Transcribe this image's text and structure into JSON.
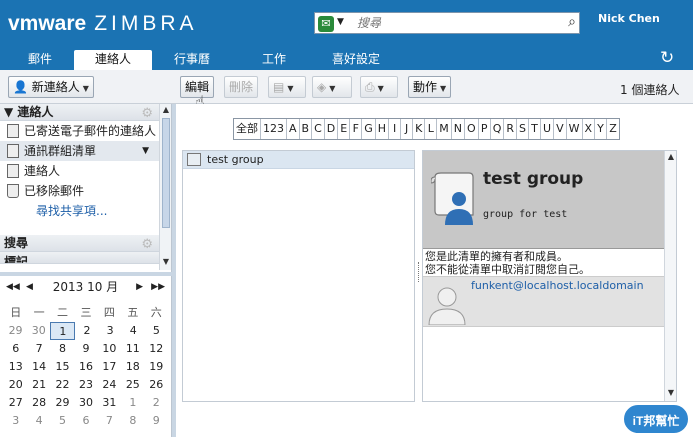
{
  "header": {
    "logo_brand": "vmware",
    "logo_product": "ZIMBRA",
    "search_placeholder": "搜尋",
    "user_name": "Nick Chen"
  },
  "tabs": [
    {
      "label": "郵件",
      "active": false
    },
    {
      "label": "連絡人",
      "active": true
    },
    {
      "label": "行事曆",
      "active": false
    },
    {
      "label": "工作",
      "active": false
    },
    {
      "label": "喜好設定",
      "active": false
    }
  ],
  "toolbar": {
    "new_contact": "新連絡人",
    "edit": "編輯",
    "delete": "刪除",
    "actions": "動作",
    "contact_count": "1 個連絡人"
  },
  "sidebar": {
    "section_contacts": "連絡人",
    "items": [
      {
        "label": "已寄送電子郵件的連絡人"
      },
      {
        "label": "通訊群組清單"
      },
      {
        "label": "連絡人"
      },
      {
        "label": "已移除郵件"
      }
    ],
    "find_shares": "尋找共享項...",
    "section_search": "搜尋",
    "section_tags": "標記"
  },
  "calendar": {
    "title": "2013 10 月",
    "weekdays": [
      "日",
      "一",
      "二",
      "三",
      "四",
      "五",
      "六"
    ],
    "weeks": [
      [
        "29",
        "30",
        "1",
        "2",
        "3",
        "4",
        "5"
      ],
      [
        "6",
        "7",
        "8",
        "9",
        "10",
        "11",
        "12"
      ],
      [
        "13",
        "14",
        "15",
        "16",
        "17",
        "18",
        "19"
      ],
      [
        "20",
        "21",
        "22",
        "23",
        "24",
        "25",
        "26"
      ],
      [
        "27",
        "28",
        "29",
        "30",
        "31",
        "1",
        "2"
      ],
      [
        "3",
        "4",
        "5",
        "6",
        "7",
        "8",
        "9"
      ]
    ],
    "today": "1"
  },
  "alphabet": [
    "全部",
    "123",
    "A",
    "B",
    "C",
    "D",
    "E",
    "F",
    "G",
    "H",
    "I",
    "J",
    "K",
    "L",
    "M",
    "N",
    "O",
    "P",
    "Q",
    "R",
    "S",
    "T",
    "U",
    "V",
    "W",
    "X",
    "Y",
    "Z"
  ],
  "list": {
    "items": [
      {
        "name": "test group"
      }
    ]
  },
  "detail": {
    "name": "test group",
    "description": "group for test",
    "note_line1": "您是此清單的擁有者和成員。",
    "note_line2": "您不能從清單中取消訂閱您自己。",
    "member_email": "funkent@localhost.localdomain"
  },
  "watermark": "iT邦幫忙"
}
